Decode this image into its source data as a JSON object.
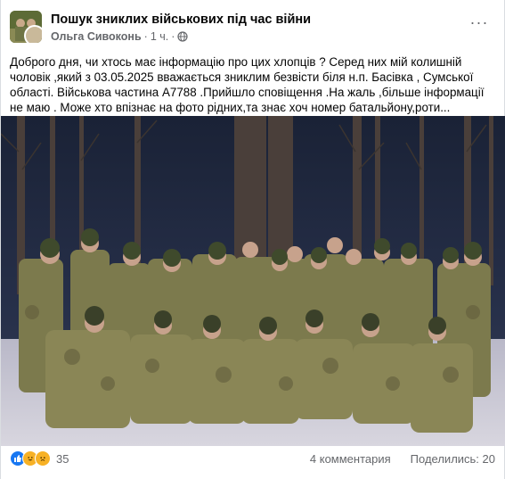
{
  "post": {
    "group_name": "Пошук зниклих військових під час війни",
    "author": "Ольга Сивоконь",
    "separator": "·",
    "time": "1 ч.",
    "more_icon": "ellipsis-icon",
    "text": "Доброго дня, чи хтось має інформацію про цих хлопців ? Серед них мій колишній чоловік ,який з 03.05.2025 вважається зниклим безвісти біля н.п. Басівка , Сумської області. Військова частина А7788 .Прийшло сповіщення .На жаль ,більше інформації не маю . Може хто впізнає на фото рідних,та знає хоч номер батальйону,роти..."
  },
  "footer": {
    "reaction_count": "35",
    "comments": "4 комментария",
    "shares": "Поделились: 20"
  },
  "colors": {
    "like": "#1877f2",
    "love": "#f33e58",
    "sad": "#f7b125",
    "camo": "#7c7a4d"
  }
}
